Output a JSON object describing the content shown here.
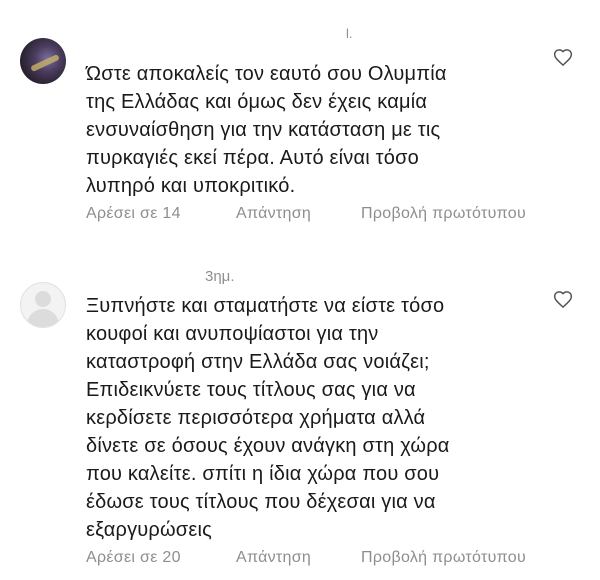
{
  "comments": [
    {
      "time": "",
      "marker": "l.",
      "text": "Ώστε αποκαλείς τον εαυτό σου Ολυμπία\nτης Ελλάδας και όμως δεν έχεις καμία\nενσυναίσθηση για την κατάσταση με τις\nπυρκαγιές εκεί πέρα. Αυτό είναι τόσο\nλυπηρό και υποκριτικό.",
      "likes_label": "Αρέσει σε 14",
      "reply_label": "Απάντηση",
      "translate_label": "Προβολή πρωτότυπου",
      "avatar": "user-avatar-photo",
      "like_icon": "heart-outline-icon"
    },
    {
      "time": "3ημ.",
      "text": "Ξυπνήστε και σταματήστε να είστε τόσο\nκουφοί και ανυποψίαστοι για την\nκαταστροφή στην Ελλάδα σας νοιάζει;\nΕπιδεικνύετε τους τίτλους σας για να\nκερδίσετε περισσότερα χρήματα αλλά\nδίνετε σε όσους έχουν ανάγκη στη χώρα\nπου καλείτε. σπίτι η ίδια χώρα που σου\nέδωσε τους τίτλους που δέχεσαι για να\nεξαργυρώσεις",
      "likes_label": "Αρέσει σε 20",
      "reply_label": "Απάντηση",
      "translate_label": "Προβολή πρωτότυπου",
      "avatar": "default-avatar-silhouette",
      "like_icon": "heart-outline-icon"
    }
  ],
  "colors": {
    "text": "#1a1a1a",
    "muted": "#8e8e8e",
    "background": "#ffffff"
  }
}
